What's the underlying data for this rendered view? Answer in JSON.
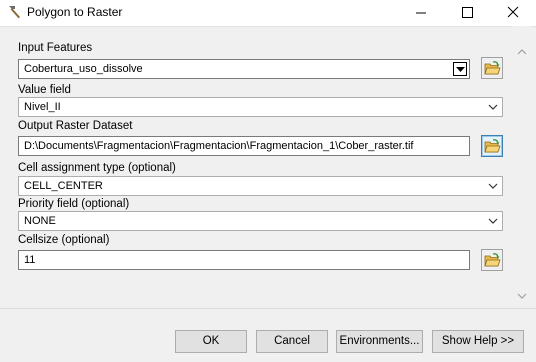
{
  "window": {
    "title": "Polygon to Raster",
    "minimize_icon": "minimize-icon",
    "maximize_icon": "maximize-icon",
    "close_icon": "close-icon",
    "app_icon": "hammer-icon"
  },
  "form": {
    "input_features": {
      "label": "Input Features",
      "value": "Cobertura_uso_dissolve"
    },
    "value_field": {
      "label": "Value field",
      "value": "Nivel_II"
    },
    "output_raster": {
      "label": "Output Raster Dataset",
      "value": "D:\\Documents\\Fragmentacion\\Fragmentacion\\Fragmentacion_1\\Cober_raster.tif"
    },
    "cell_assignment": {
      "label": "Cell assignment type (optional)",
      "value": "CELL_CENTER"
    },
    "priority_field": {
      "label": "Priority field (optional)",
      "value": "NONE"
    },
    "cellsize": {
      "label": "Cellsize (optional)",
      "value": "11"
    }
  },
  "buttons": {
    "ok": "OK",
    "cancel": "Cancel",
    "environments": "Environments...",
    "show_help": "Show Help >>"
  },
  "colors": {
    "folder_yellow": "#e8b94a",
    "folder_green_arrow": "#3a9a3a",
    "active_border": "#3c7fb1"
  }
}
